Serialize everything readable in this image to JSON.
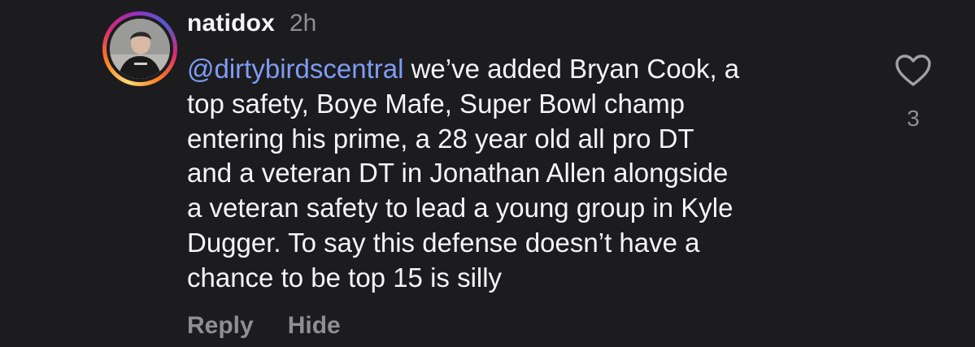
{
  "comment": {
    "username": "natidox",
    "timestamp": "2h",
    "mention": "@dirtybirdscentral",
    "lines": [
      " we’ve added Bryan Cook, a",
      "top safety, Boye Mafe, Super Bowl champ",
      "entering his prime, a 28 year old all pro DT",
      "and a veteran DT in Jonathan Allen alongside",
      "a veteran safety to lead a young group in Kyle",
      "Dugger. To say this defense doesn’t have a",
      "chance to be top 15 is silly"
    ],
    "actions": {
      "reply": "Reply",
      "hide": "Hide"
    },
    "like_count": "3"
  },
  "colors": {
    "background": "#1c1c1e",
    "text": "#f5f5f5",
    "secondary_text": "#8e8e93",
    "mention": "#7f9cf5"
  },
  "icons": {
    "like": "heart-icon"
  }
}
